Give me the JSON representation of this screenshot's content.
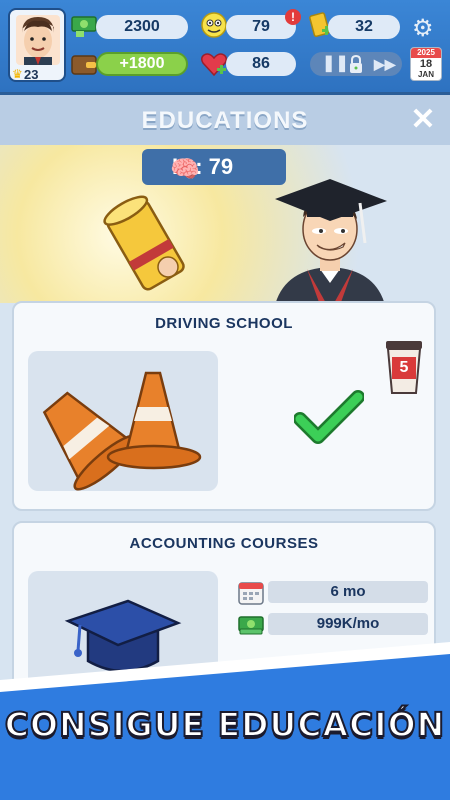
{
  "player": {
    "level": "23"
  },
  "stats": {
    "money": "2300",
    "income": "+1800",
    "iq": "79",
    "iq_alert": "!",
    "health": "86",
    "cards": "32"
  },
  "date": {
    "year": "2025",
    "day": "18",
    "month": "JAN"
  },
  "panel": {
    "title": "EDUCATIONS",
    "close_label": "✕",
    "iq_badge": "IQ: 79"
  },
  "courses": [
    {
      "title": "DRIVING SCHOOL",
      "cost_badge": "5",
      "completed": true
    },
    {
      "title": "ACCOUNTING COURSES",
      "duration": "6 mo",
      "price": "999K/mo"
    }
  ],
  "banner": {
    "text": "CONSIGUE EDUCACIÓN"
  },
  "colors": {
    "accent_blue": "#2c6fc4",
    "panel_bg": "#d7e4f1",
    "check_green": "#33c24a",
    "banner_dark": "#1b1b2e"
  },
  "icons": [
    "avatar",
    "crown-icon",
    "money-icon",
    "wallet-icon",
    "iq-face-icon",
    "heart-icon",
    "card-icon",
    "gear-icon",
    "pause-icon",
    "lock-icon",
    "fast-forward-icon",
    "calendar-icon",
    "brain-icon",
    "diploma-scroll-icon",
    "traffic-cone-icon",
    "coffee-cup-icon",
    "checkmark-icon",
    "graduation-cap-icon",
    "calendar-small-icon",
    "cash-icon",
    "close-icon"
  ]
}
